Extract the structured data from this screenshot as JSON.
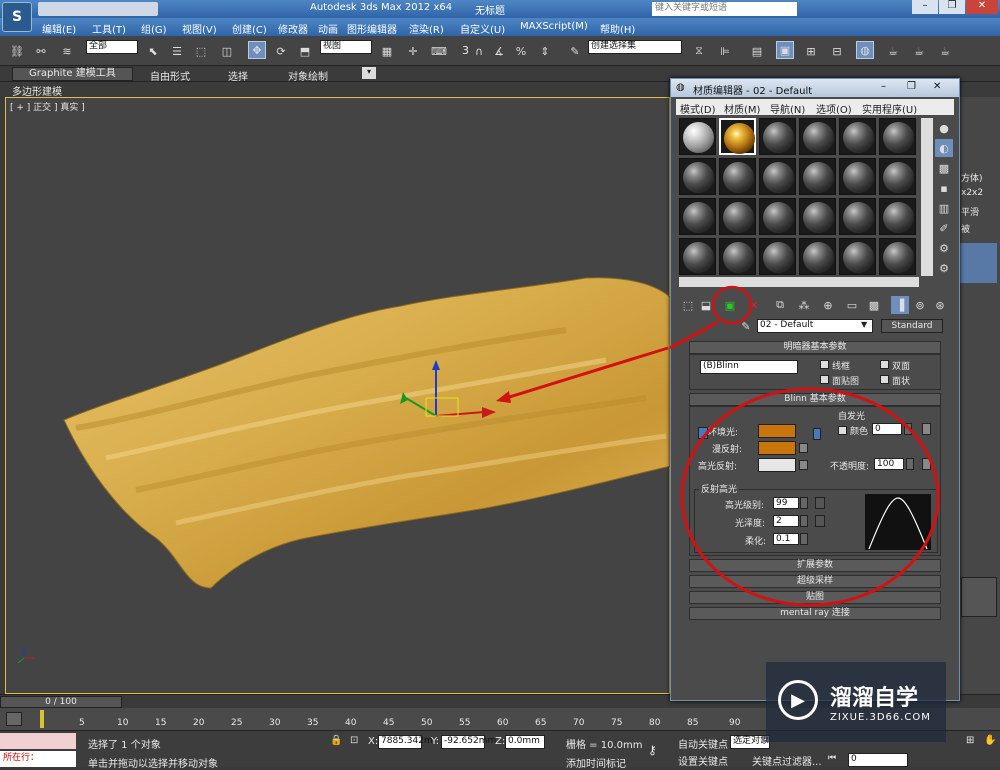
{
  "app": {
    "title": "Autodesk 3ds Max  2012 x64",
    "doc": "无标题",
    "search_placeholder": "键入关键字或短语"
  },
  "menu": [
    "编辑(E)",
    "工具(T)",
    "组(G)",
    "视图(V)",
    "创建(C)",
    "修改器",
    "动画",
    "图形编辑器",
    "渲染(R)",
    "自定义(U)",
    "MAXScript(M)",
    "帮助(H)"
  ],
  "toolbar": {
    "select_filter": "全部",
    "ref_coord": "视图",
    "named_sel": "创建选择集",
    "num3": "3"
  },
  "ribbon": {
    "tabs": [
      "Graphite 建模工具",
      "自由形式",
      "选择",
      "对象绘制"
    ],
    "subtab": "多边形建模"
  },
  "viewport": {
    "label": "[ + ] 正交 ] 真实 ]"
  },
  "right_panel": {
    "labels": [
      "方体)",
      "x2x2",
      "平滑",
      "被"
    ]
  },
  "timeline": {
    "counter": "0 / 100"
  },
  "ruler": {
    "ticks": [
      "5",
      "10",
      "15",
      "20",
      "25",
      "30",
      "35",
      "40",
      "45",
      "50",
      "55",
      "60",
      "65",
      "70",
      "75",
      "80",
      "85",
      "90"
    ]
  },
  "status": {
    "selected": "选择了 1 个对象",
    "hint": "单击并拖动以选择并移动对象",
    "running": "所在行：",
    "x_label": "X:",
    "x": "7885.342m",
    "y_label": "Y:",
    "y": "-92.652mm",
    "z_label": "Z:",
    "z": "0.0mm",
    "grid": "栅格 = 10.0mm",
    "add_key": "添加时间标记",
    "auto_key": "自动关键点",
    "set_key": "设置关键点",
    "selected_obj": "选定对象",
    "key_filter": "关键点过滤器...",
    "frame": "0"
  },
  "dialog": {
    "title": "材质编辑器 - 02 - Default",
    "menu": [
      "模式(D)",
      "材质(M)",
      "导航(N)",
      "选项(O)",
      "实用程序(U)"
    ],
    "material_name": "02 - Default",
    "material_type": "Standard",
    "shader_rollout": {
      "title": "明暗器基本参数",
      "shader": "(B)Blinn",
      "wire": "线框",
      "two_sided": "双面",
      "face_map": "面贴图",
      "faceted": "面状"
    },
    "blinn_rollout": {
      "title": "Blinn 基本参数",
      "self_illum": "自发光",
      "color": "颜色",
      "color_val": "0",
      "ambient": "环境光:",
      "diffuse": "漫反射:",
      "specular": "高光反射:",
      "opacity": "不透明度:",
      "opacity_val": "100",
      "ambient_color": "#c8760c",
      "diffuse_color": "#c8760c",
      "specular_color": "#e6e6e6"
    },
    "highlight": {
      "title": "反射高光",
      "level_label": "高光级别:",
      "level": "99",
      "gloss_label": "光泽度:",
      "gloss": "2",
      "soften_label": "柔化:",
      "soften": "0.1"
    },
    "collapsed": [
      "扩展参数",
      "超级采样",
      "贴图",
      "mental ray 连接"
    ]
  },
  "watermark": {
    "brand": "溜溜自学",
    "url": "ZIXUE.3D66.COM"
  },
  "colors": {
    "annotation_red": "#d41010",
    "gold": "#d8ad4c"
  }
}
